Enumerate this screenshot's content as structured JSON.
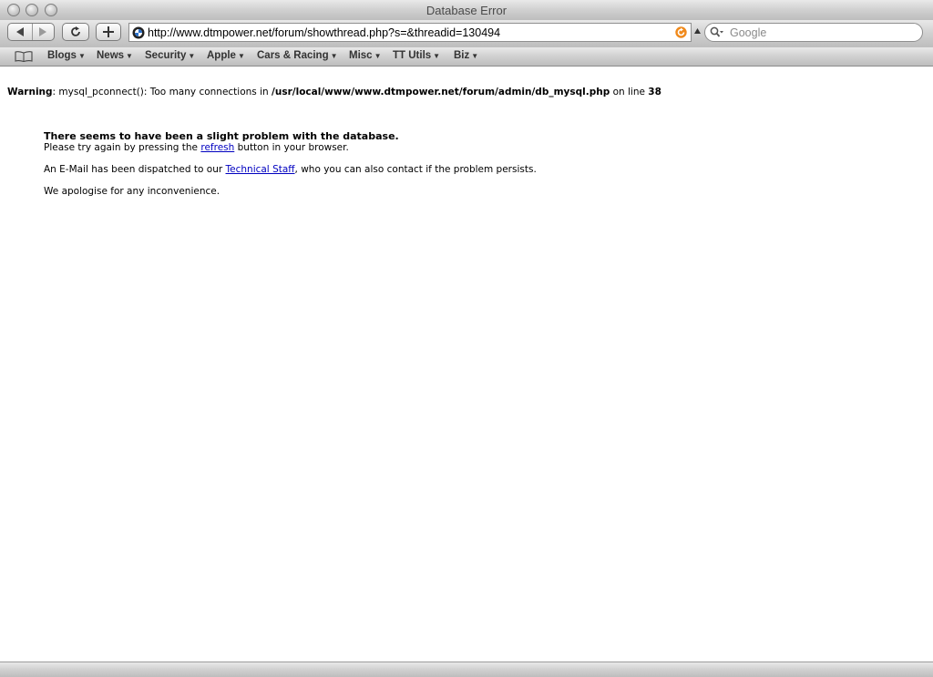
{
  "window": {
    "title": "Database Error"
  },
  "toolbar": {
    "url": "http://www.dtmpower.net/forum/showthread.php?s=&threadid=130494",
    "search_placeholder": "Google"
  },
  "bookmarks": [
    {
      "label": "Blogs"
    },
    {
      "label": "News"
    },
    {
      "label": "Security"
    },
    {
      "label": "Apple"
    },
    {
      "label": "Cars & Racing"
    },
    {
      "label": "Misc"
    },
    {
      "label": "TT Utils"
    },
    {
      "label": "Biz"
    }
  ],
  "warning": {
    "prefix": "Warning",
    "message": ": mysql_pconnect(): Too many connections in ",
    "path": "/usr/local/www/www.dtmpower.net/forum/admin/db_mysql.php",
    "on_line": " on line ",
    "line": "38"
  },
  "error": {
    "heading": "There seems to have been a slight problem with the database.",
    "retry_before": "Please try again by pressing the ",
    "retry_link": "refresh",
    "retry_after": " button in your browser.",
    "email_before": "An E-Mail has been dispatched to our ",
    "email_link": "Technical Staff",
    "email_after": ", who you can also contact if the problem persists.",
    "apology": "We apologise for any inconvenience."
  }
}
